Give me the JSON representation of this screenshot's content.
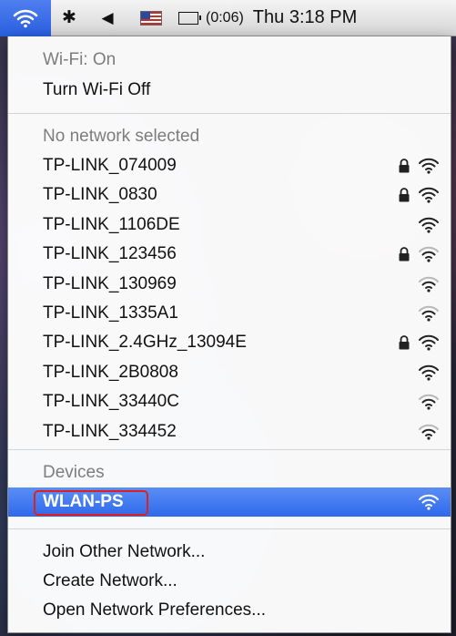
{
  "menubar": {
    "wifi_icon": "wifi-icon",
    "bluetooth_icon": "bluetooth-icon",
    "bluetooth_glyph": "✱",
    "volume_icon": "volume-icon",
    "volume_glyph": "◀",
    "flag_icon": "us-flag-icon",
    "battery_icon": "battery-icon",
    "battery_time": "(0:06)",
    "clock": "Thu 3:18 PM"
  },
  "wifi_menu": {
    "status": "Wi-Fi: On",
    "toggle_label": "Turn Wi-Fi Off",
    "no_network_label": "No network selected",
    "networks": [
      {
        "name": "TP-LINK_074009",
        "locked": true,
        "signal": "strong"
      },
      {
        "name": "TP-LINK_0830",
        "locked": true,
        "signal": "strong"
      },
      {
        "name": "TP-LINK_1106DE",
        "locked": false,
        "signal": "strong"
      },
      {
        "name": "TP-LINK_123456",
        "locked": true,
        "signal": "weak"
      },
      {
        "name": "TP-LINK_130969",
        "locked": false,
        "signal": "weak"
      },
      {
        "name": "TP-LINK_1335A1",
        "locked": false,
        "signal": "weak"
      },
      {
        "name": "TP-LINK_2.4GHz_13094E",
        "locked": true,
        "signal": "strong"
      },
      {
        "name": "TP-LINK_2B0808",
        "locked": false,
        "signal": "strong"
      },
      {
        "name": "TP-LINK_33440C",
        "locked": false,
        "signal": "weak"
      },
      {
        "name": "TP-LINK_334452",
        "locked": false,
        "signal": "weak"
      }
    ],
    "devices_label": "Devices",
    "device": {
      "name": "WLAN-PS",
      "signal": "strong"
    },
    "join_other": "Join Other Network...",
    "create_network": "Create Network...",
    "open_prefs": "Open Network Preferences..."
  },
  "colors": {
    "selection": "#2f69ea",
    "highlight_border": "#e02020",
    "wifi_tile": "#2a5fe0"
  }
}
